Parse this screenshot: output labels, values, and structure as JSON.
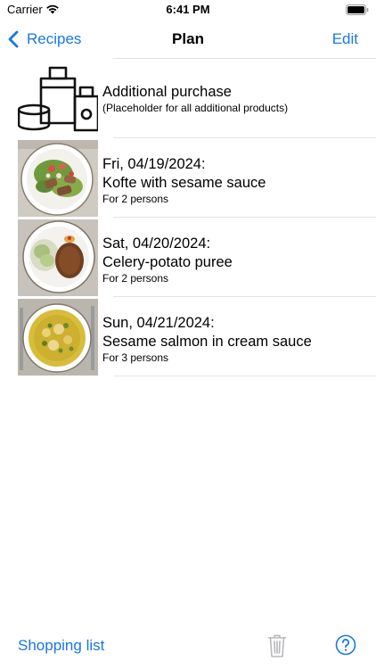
{
  "status_bar": {
    "carrier": "Carrier",
    "time": "6:41 PM",
    "icons": [
      "wifi-icon",
      "battery-icon"
    ]
  },
  "nav": {
    "back_label": "Recipes",
    "title": "Plan",
    "edit_label": "Edit"
  },
  "plan_items": [
    {
      "title": "Additional purchase",
      "subtitle": "(Placeholder for all additional products)",
      "icon": "groceries-icon"
    },
    {
      "date": "Fri, 04/19/2024:",
      "title": "Kofte with sesame sauce",
      "persons": "For 2 persons",
      "image": "kofte-photo"
    },
    {
      "date": "Sat, 04/20/2024:",
      "title": "Celery-potato puree",
      "persons": "For 2 persons",
      "image": "celery-potato-photo"
    },
    {
      "date": "Sun, 04/21/2024:",
      "title": "Sesame salmon in cream sauce",
      "persons": "For 3 persons",
      "image": "salmon-photo"
    }
  ],
  "toolbar": {
    "shopping_label": "Shopping list",
    "icons": [
      "trash-icon",
      "help-icon"
    ]
  },
  "colors": {
    "accent": "#1877e6",
    "separator": "#e4e4e6",
    "disabled": "#b8b8bc"
  }
}
